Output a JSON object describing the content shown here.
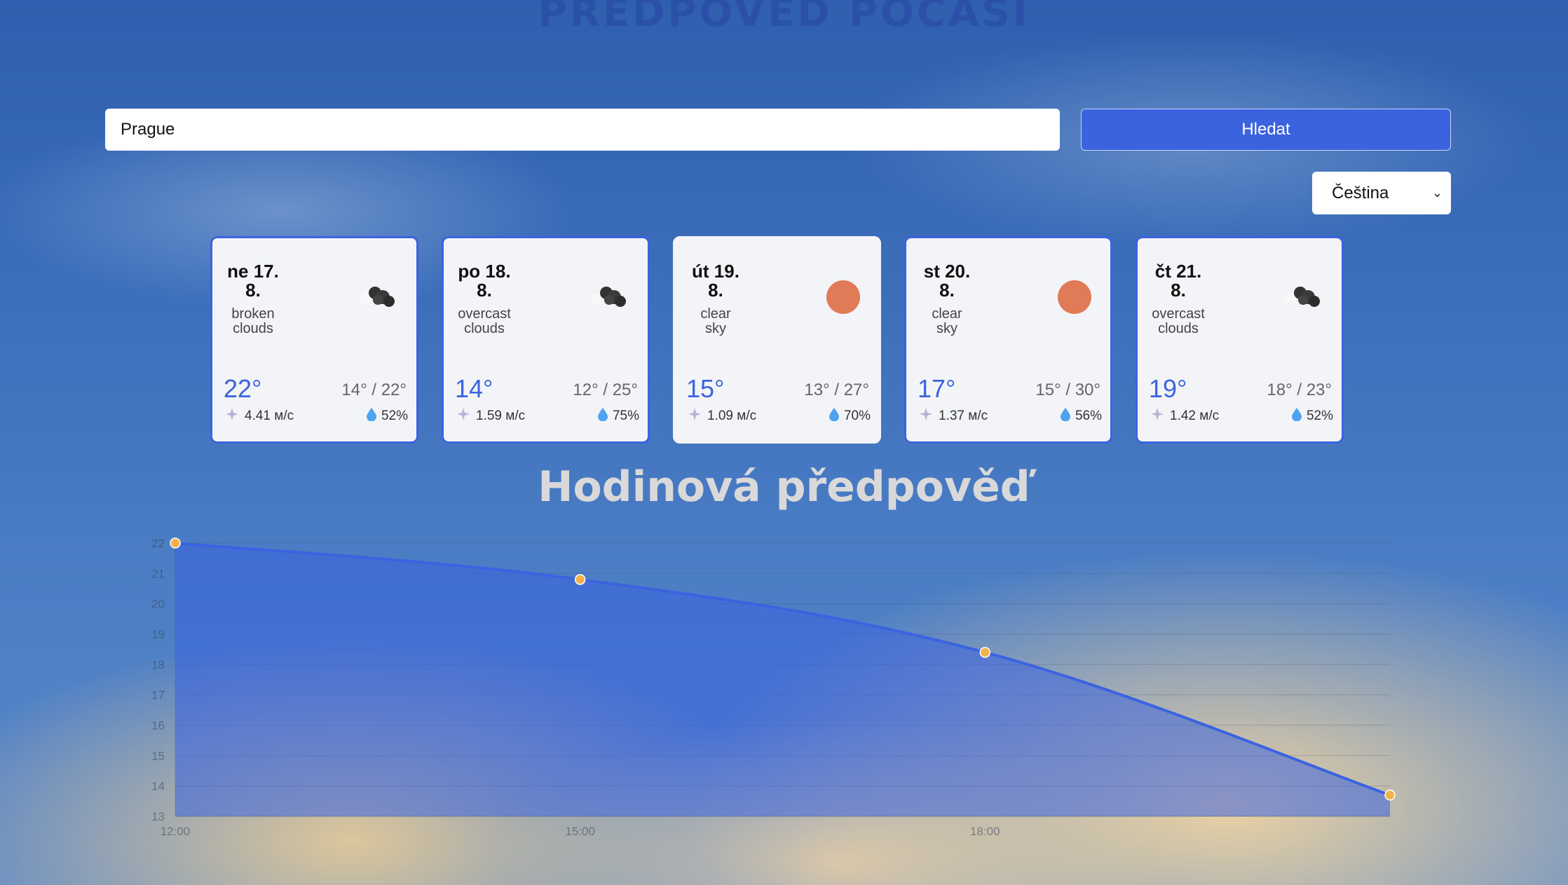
{
  "page": {
    "title": "PŘEDPOVĚĎ POČASÍ"
  },
  "search": {
    "value": "Prague",
    "button_label": "Hledat"
  },
  "language": {
    "selected": "Čeština"
  },
  "forecast": [
    {
      "date": "ne 17.\n8.",
      "description": "broken\nclouds",
      "icon": "cloud-icon",
      "temp": "22°",
      "range": "14° / 22°",
      "wind": "4.41 м/с",
      "humidity": "52%",
      "highlighted": true
    },
    {
      "date": "po 18.\n8.",
      "description": "overcast\nclouds",
      "icon": "cloud-icon",
      "temp": "14°",
      "range": "12° / 25°",
      "wind": "1.59 м/с",
      "humidity": "75%",
      "highlighted": true
    },
    {
      "date": "út 19.\n8.",
      "description": "clear\nsky",
      "icon": "sun-icon",
      "temp": "15°",
      "range": "13° / 27°",
      "wind": "1.09 м/с",
      "humidity": "70%",
      "highlighted": false
    },
    {
      "date": "st 20.\n8.",
      "description": "clear\nsky",
      "icon": "sun-icon",
      "temp": "17°",
      "range": "15° / 30°",
      "wind": "1.37 м/с",
      "humidity": "56%",
      "highlighted": true
    },
    {
      "date": "čt 21.\n8.",
      "description": "overcast\nclouds",
      "icon": "cloud-icon",
      "temp": "19°",
      "range": "18° / 23°",
      "wind": "1.42 м/с",
      "humidity": "52%",
      "highlighted": true
    }
  ],
  "hourly": {
    "title": "Hodinová předpověď"
  },
  "colors": {
    "accent": "#3b63e0",
    "sun": "#e07a57",
    "point": "#f2b24a"
  },
  "chart_data": {
    "type": "area",
    "x": [
      "12:00",
      "15:00",
      "18:00",
      "21:00"
    ],
    "x_tick_labels": [
      "12:00",
      "15:00",
      "18:00"
    ],
    "values": [
      22,
      20.8,
      18.4,
      13.7
    ],
    "ylim": [
      13,
      22
    ],
    "yticks": [
      13,
      14,
      15,
      16,
      17,
      18,
      19,
      20,
      21,
      22
    ],
    "grid": true
  }
}
